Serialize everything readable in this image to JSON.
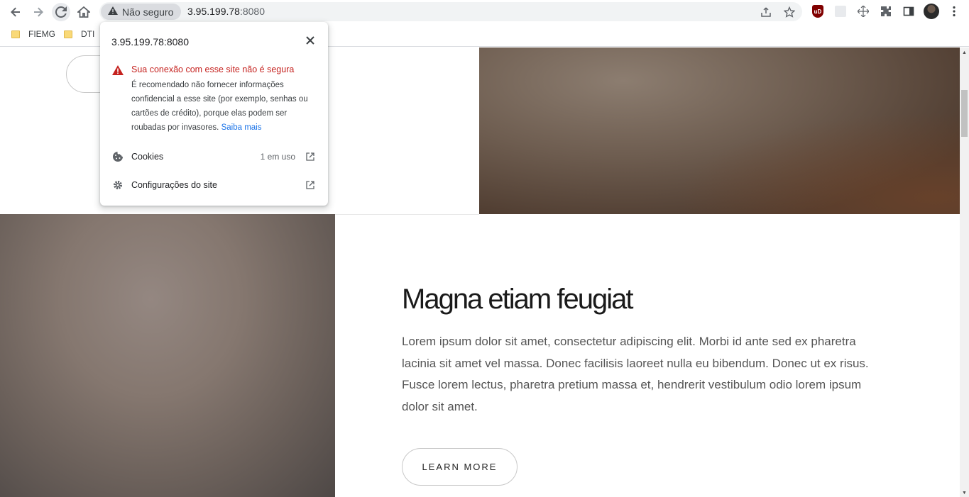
{
  "browser": {
    "security_label": "Não seguro",
    "url_host": "3.95.199.78",
    "url_port": ":8080",
    "bookmarks": [
      {
        "label": "FIEMG"
      },
      {
        "label": "DTI"
      }
    ],
    "extension_ublock_label": "uD"
  },
  "popup": {
    "title": "3.95.199.78:8080",
    "warning_heading": "Sua conexão com esse site não é segura",
    "warning_body": "É recomendado não fornecer informações confidencial a esse site (por exemplo, senhas ou cartões de crédito), porque elas podem ser roubadas por invasores.",
    "warning_link": "Saiba mais",
    "cookies_label": "Cookies",
    "cookies_meta": "1 em uso",
    "site_settings_label": "Configurações do site"
  },
  "page": {
    "heading": "Magna etiam feugiat",
    "paragraph": "Lorem ipsum dolor sit amet, consectetur adipiscing elit. Morbi id ante sed ex pharetra lacinia sit amet vel massa. Donec facilisis laoreet nulla eu bibendum. Donec ut ex risus. Fusce lorem lectus, pharetra pretium massa et, hendrerit vestibulum odio lorem ipsum dolor sit amet.",
    "button_label": "LEARN MORE"
  },
  "colors": {
    "warning_red": "#c5221f",
    "link_blue": "#1a73e8",
    "security_chip": "#dadce0"
  }
}
